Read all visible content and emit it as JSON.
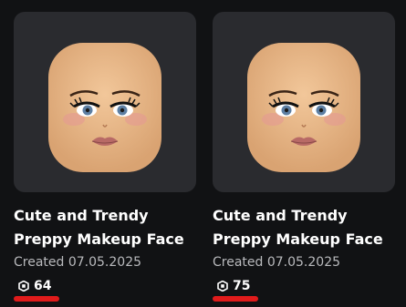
{
  "items": [
    {
      "title": "Cute and Trendy Preppy Makeup Face",
      "created": "Created 07.05.2025",
      "price": "64",
      "currency_icon": "robux-icon"
    },
    {
      "title": "Cute and Trendy Preppy Makeup Face",
      "created": "Created 07.05.2025",
      "price": "75",
      "currency_icon": "robux-icon"
    }
  ],
  "colors": {
    "background": "#111214",
    "thumbnail": "#2a2b2f",
    "underline": "#e01b1b",
    "muted_text": "#b9babd"
  }
}
